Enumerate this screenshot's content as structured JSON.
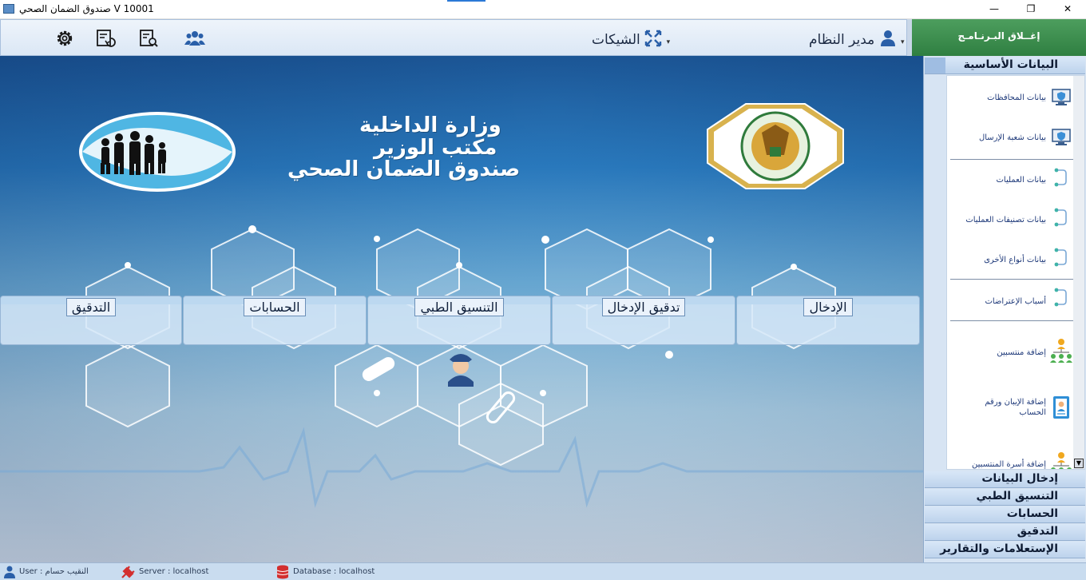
{
  "window": {
    "title": "صندوق الضمان الصحي   V 10001",
    "minimize_icon": "minimize-icon",
    "maximize_icon": "restore-icon",
    "close_icon": "close-icon",
    "minimize_glyph": "—",
    "maximize_glyph": "❐",
    "close_glyph": "✕"
  },
  "toolbar": {
    "icons": [
      "settings-icon",
      "refresh-list-icon",
      "report-search-icon",
      "users-group-icon"
    ],
    "cheques_menu": "الشيكات",
    "user_menu": "مدير النظام",
    "close_program": "إغــلاق البـرنـامـج"
  },
  "banner": {
    "line1": "وزارة الداخلية",
    "line2": "مكتب الوزير",
    "line3": "صندوق الضمان الصحي"
  },
  "nav_tiles": [
    {
      "label": "الإدخال"
    },
    {
      "label": "تدقيق الإدخال"
    },
    {
      "label": "التنسيق الطبي"
    },
    {
      "label": "الحسابات"
    },
    {
      "label": "التدقيق"
    }
  ],
  "sidebar": {
    "sections": [
      "البيانات الأساسية",
      "إدخال البيانات",
      "التنسيق الطبي",
      "الحسابات",
      "التدقيق",
      "الإستعلامات والتقارير"
    ],
    "items": [
      {
        "label": "بيانات المحافظات",
        "icon": "monitor-shield-icon"
      },
      {
        "label": "بيانات شعبة الإرسال",
        "icon": "monitor-shield-icon"
      },
      {
        "label": "بيانات العمليات",
        "icon": "flow-link-icon"
      },
      {
        "label": "بيانات تصنيفات العمليات",
        "icon": "flow-link-icon"
      },
      {
        "label": "بيانات أنواع الأخرى",
        "icon": "flow-link-icon"
      },
      {
        "label": "أسباب الإعتراضات",
        "icon": "flow-link-icon"
      },
      {
        "label": "إضافة منتسبين",
        "icon": "org-people-icon"
      },
      {
        "label": "إضافة الإيبان ورقم الحساب",
        "icon": "id-card-icon"
      },
      {
        "label": "إضافة أسرة المنتسبين",
        "icon": "org-people-icon"
      }
    ]
  },
  "status": {
    "user": "User : النقيب حسام",
    "server": "Server : localhost",
    "database": "Database : localhost"
  },
  "colors": {
    "accent_green": "#3a8a4c",
    "toolbar_text": "#1d2b44",
    "sidebar_link": "#1f3a7a"
  }
}
